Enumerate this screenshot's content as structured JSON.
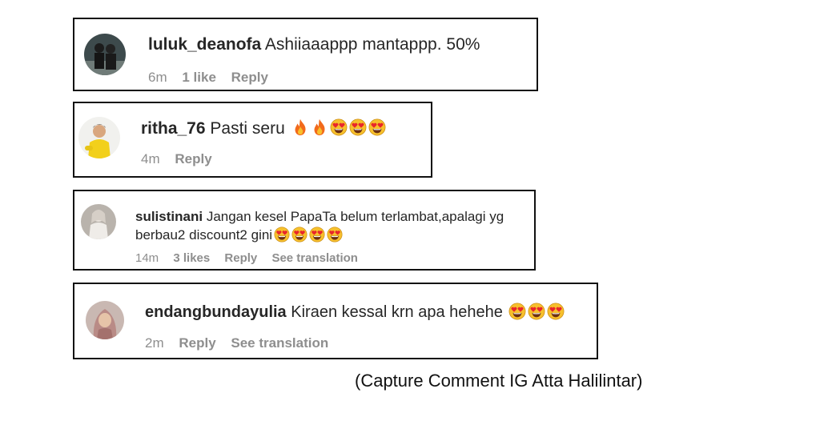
{
  "comments": [
    {
      "username": "luluk_deanofa",
      "text": "Ashiiaaappp mantappp. 50%",
      "emojis": [],
      "time": "6m",
      "likes": "1 like",
      "reply": "Reply",
      "translation": ""
    },
    {
      "username": "ritha_76",
      "text": "Pasti seru",
      "emojis": [
        "fire-emoji",
        "fire-emoji",
        "heart-eyes-emoji",
        "heart-eyes-emoji",
        "heart-eyes-emoji"
      ],
      "time": "4m",
      "likes": "",
      "reply": "Reply",
      "translation": ""
    },
    {
      "username": "sulistinani",
      "text": "Jangan kesel PapaTa belum terlambat,apalagi yg berbau2 discount2 gini",
      "emojis": [
        "heart-eyes-emoji",
        "heart-eyes-emoji",
        "heart-eyes-emoji",
        "heart-eyes-emoji"
      ],
      "time": "14m",
      "likes": "3 likes",
      "reply": "Reply",
      "translation": "See translation"
    },
    {
      "username": "endangbundayulia",
      "text": "Kiraen kessal krn apa hehehe",
      "emojis": [
        "heart-eyes-emoji",
        "heart-eyes-emoji",
        "heart-eyes-emoji"
      ],
      "time": "2m",
      "likes": "",
      "reply": "Reply",
      "translation": "See translation"
    }
  ],
  "caption": "(Capture Comment IG Atta Halilintar)",
  "colors": {
    "text": "#262626",
    "meta": "#8e8e8e",
    "border": "#111111",
    "emoji_face": "#f7c02c",
    "emoji_heart": "#e8262b",
    "emoji_fire": "#f26a1b"
  }
}
